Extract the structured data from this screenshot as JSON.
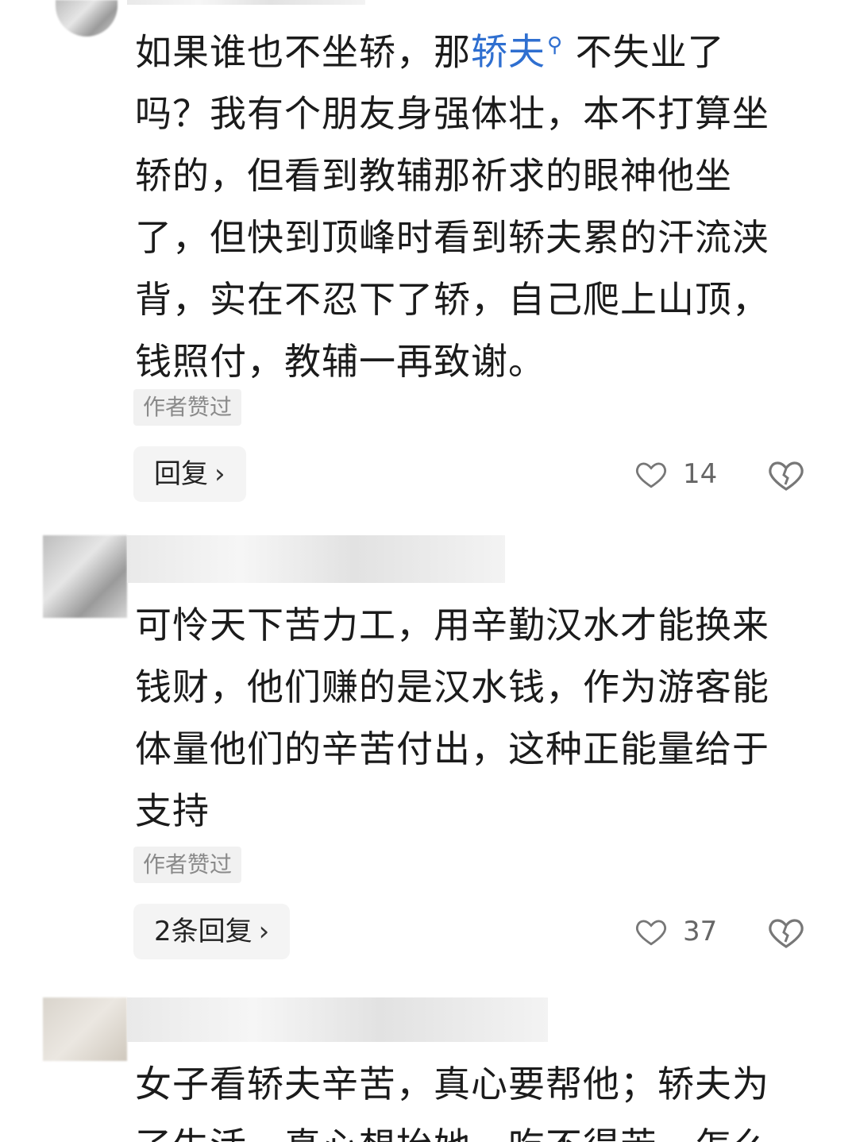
{
  "comments": [
    {
      "text_before": "如果谁也不坐轿，那",
      "keyword": "轿夫",
      "search_glyph": "⚲",
      "text_after": " 不失业了吗？我有个朋友身强体壮，本不打算坐轿的，但看到教辅那祈求的眼神他坐了，但快到顶峰时看到轿夫累的汗流浃背，实在不忍下了轿，自己爬上山顶，钱照付，教辅一再致谢。",
      "badge": "作者赞过",
      "reply_label": "回复",
      "likes": "14"
    },
    {
      "text": "可怜天下苦力工，用辛勤汉水才能换来钱财，他们赚的是汉水钱，作为游客能体量他们的辛苦付出，这种正能量给于支持",
      "badge": "作者赞过",
      "reply_label": "2条回复",
      "likes": "37"
    },
    {
      "text": "女子看轿夫辛苦，真心要帮他；轿夫为了生活，真心想抬她，吃不得苦，怎么"
    }
  ],
  "icons": {
    "reply_chevron": "chevron-right-icon",
    "like": "heart-outline-icon",
    "dislike": "broken-heart-icon"
  },
  "colors": {
    "link": "#2f6fd0",
    "text": "#1b1b1b",
    "muted": "#8a8a8a"
  }
}
